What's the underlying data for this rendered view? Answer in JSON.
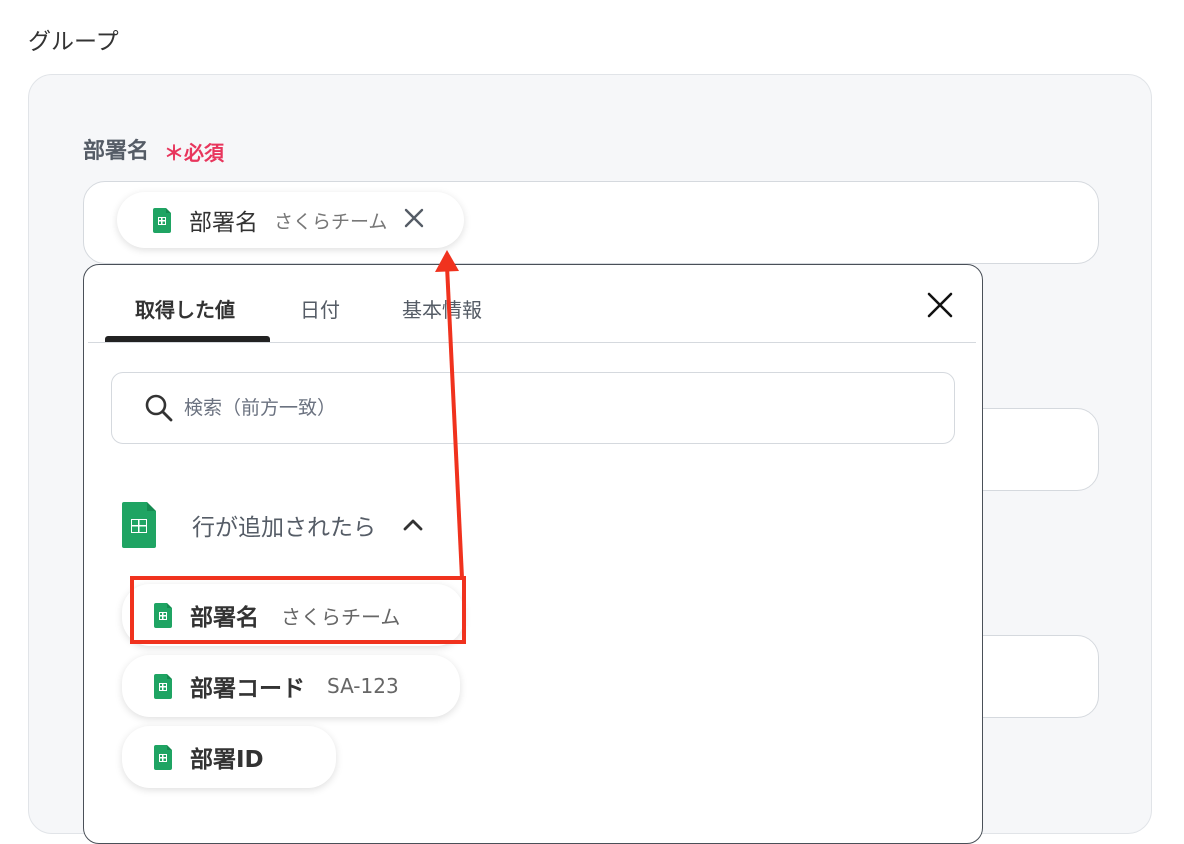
{
  "section_title": "グループ",
  "field": {
    "label": "部署名",
    "required_mark": "＊",
    "required_text": "必須"
  },
  "selected_chip": {
    "icon": "google-sheets-icon",
    "name": "部署名",
    "value": "さくらチーム",
    "remove_icon": "close-icon"
  },
  "dropdown": {
    "tabs": [
      {
        "label": "取得した値",
        "active": true
      },
      {
        "label": "日付",
        "active": false
      },
      {
        "label": "基本情報",
        "active": false
      }
    ],
    "search_placeholder": "検索（前方一致）",
    "group": {
      "icon": "google-sheets-icon",
      "label": "行が追加されたら",
      "expanded": true,
      "items": [
        {
          "name": "部署名",
          "value": "さくらチーム"
        },
        {
          "name": "部署コード",
          "value": "SA-123"
        },
        {
          "name": "部署ID",
          "value": ""
        }
      ]
    }
  },
  "colors": {
    "accent_required": "#e8365d",
    "sheets_green": "#1fa463",
    "annotation_red": "#f0321e"
  }
}
